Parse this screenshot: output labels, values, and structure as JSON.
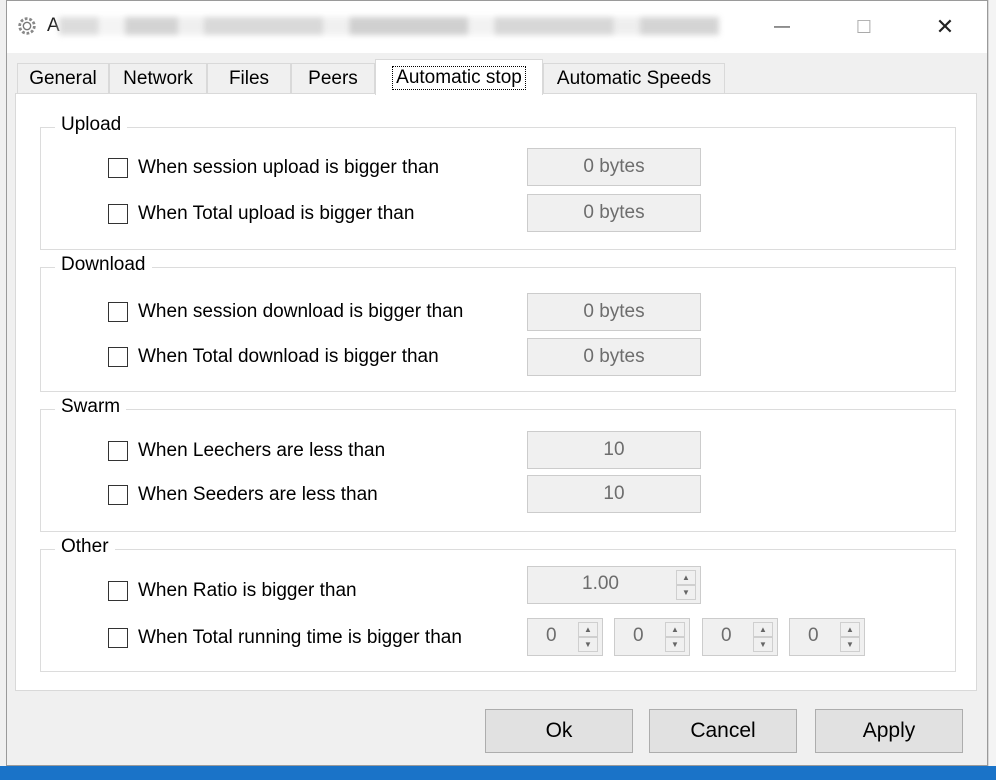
{
  "window": {
    "title_prefix": "A",
    "minimize_label": "—",
    "maximize_label": "☐",
    "close_label": "✕"
  },
  "tabs": [
    {
      "label": "General",
      "active": false
    },
    {
      "label": "Network",
      "active": false
    },
    {
      "label": "Files",
      "active": false
    },
    {
      "label": "Peers",
      "active": false
    },
    {
      "label": "Automatic stop",
      "active": true
    },
    {
      "label": "Automatic Speeds",
      "active": false
    }
  ],
  "groups": {
    "upload": {
      "title": "Upload",
      "rows": [
        {
          "label": "When session upload is bigger than",
          "value": "0 bytes",
          "checked": false
        },
        {
          "label": "When Total upload is bigger than",
          "value": "0 bytes",
          "checked": false
        }
      ]
    },
    "download": {
      "title": "Download",
      "rows": [
        {
          "label": "When session download is bigger than",
          "value": "0 bytes",
          "checked": false
        },
        {
          "label": "When Total download is bigger than",
          "value": "0 bytes",
          "checked": false
        }
      ]
    },
    "swarm": {
      "title": "Swarm",
      "rows": [
        {
          "label": "When Leechers are less than",
          "value": "10",
          "checked": false
        },
        {
          "label": "When Seeders are less than",
          "value": "10",
          "checked": false
        }
      ]
    },
    "other": {
      "title": "Other",
      "rows": [
        {
          "label": "When Ratio is bigger than",
          "value": "1.00",
          "checked": false
        },
        {
          "label": "When Total running time is bigger than",
          "values": [
            "0",
            "0",
            "0",
            "0"
          ],
          "checked": false
        }
      ]
    }
  },
  "buttons": {
    "ok": "Ok",
    "cancel": "Cancel",
    "apply": "Apply"
  },
  "colors": {
    "window_bg": "#f0f0f0",
    "panel_bg": "#ffffff",
    "disabled_text": "#6d6d6d",
    "taskbar": "#1a73c8"
  }
}
